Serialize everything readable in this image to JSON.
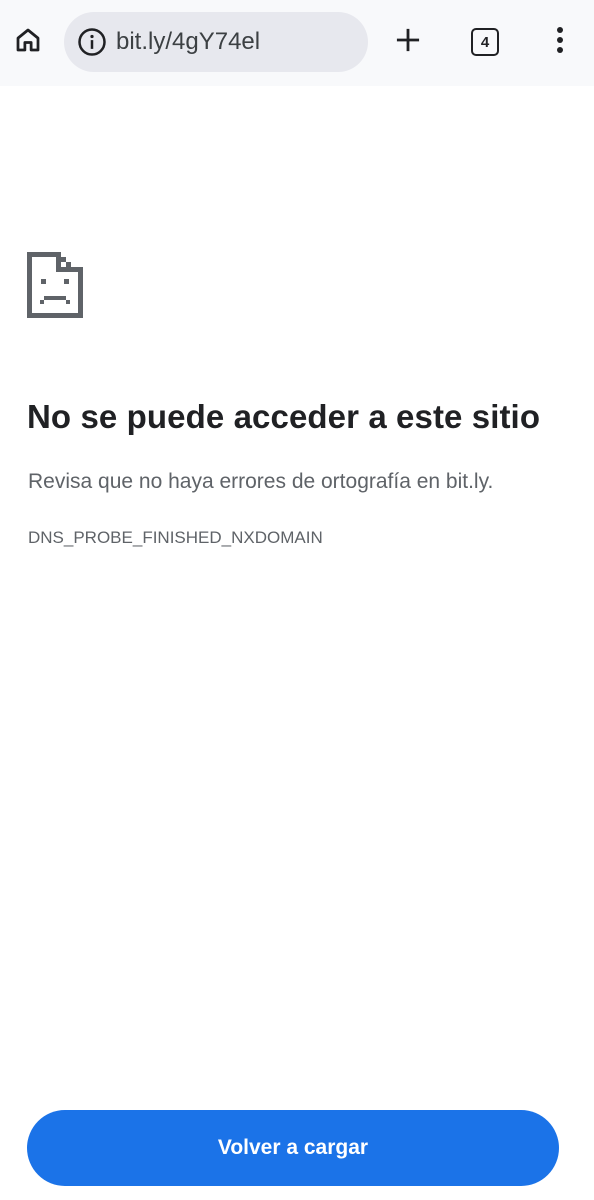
{
  "toolbar": {
    "home_icon": "home-icon",
    "info_icon": "info-icon",
    "url": "bit.ly/4gY74el",
    "new_tab_icon": "plus-icon",
    "tab_count": "4",
    "menu_icon": "more-vert-icon"
  },
  "error": {
    "icon": "sad-page-icon",
    "title": "No se puede acceder a este sitio",
    "description": "Revisa que no haya errores de ortografía en bit.ly.",
    "code": "DNS_PROBE_FINISHED_NXDOMAIN"
  },
  "actions": {
    "reload_label": "Volver a cargar"
  },
  "colors": {
    "toolbar_bg": "#f8f9fb",
    "omnibox_bg": "#e7e8ee",
    "primary_button": "#1b73e8",
    "title_text": "#202124",
    "secondary_text": "#5f6368"
  }
}
